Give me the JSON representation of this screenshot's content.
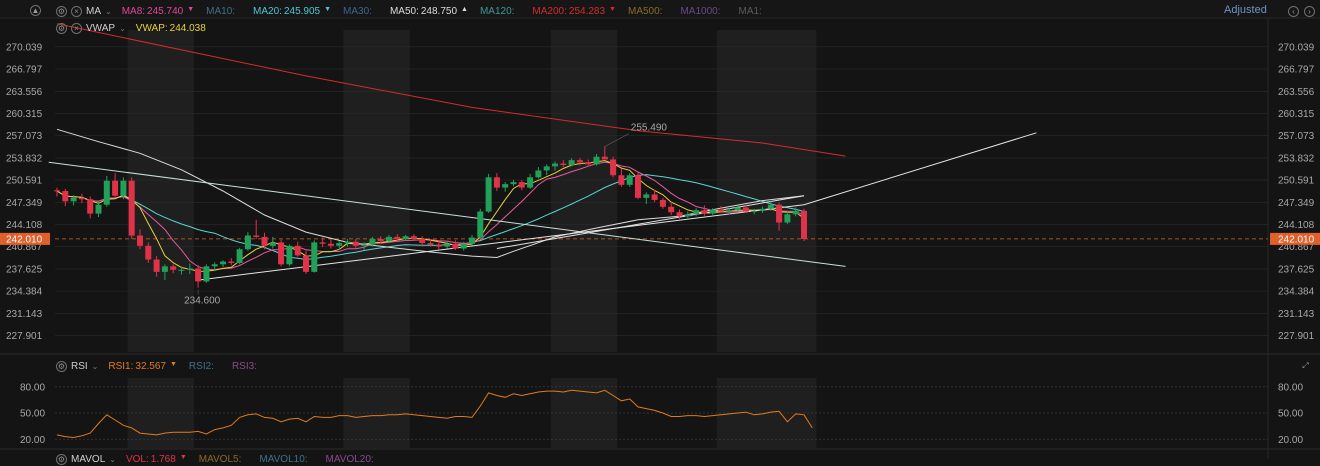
{
  "colors": {
    "bg": "#141414",
    "band": "#1f1f1f",
    "grid": "#2a2a2a",
    "up": "#21a05a",
    "down": "#e0334a",
    "ma8": "#e85aa0",
    "ma20": "#5ad5d5",
    "ma200": "#d62b2b",
    "white": "#e6e6e6",
    "vwap": "#e8d23a",
    "rsi": "#e07b1e",
    "price_line": "#e0602a"
  },
  "top_bar": {
    "collapse_icon": "triangle-up-icon",
    "indicator": "MA",
    "items": [
      {
        "key": "MA8:",
        "value": "245.740",
        "color": "#e0479a",
        "arrow": "▼"
      },
      {
        "key": "MA10:",
        "value": "",
        "color": "#3e7088",
        "arrow": ""
      },
      {
        "key": "MA20:",
        "value": "245.905",
        "color": "#4fc6d6",
        "arrow": "▼"
      },
      {
        "key": "MA30:",
        "value": "",
        "color": "#3e6496",
        "arrow": ""
      },
      {
        "key": "MA50:",
        "value": "248.750",
        "color": "#dcdcdc",
        "arrow": "▲"
      },
      {
        "key": "MA120:",
        "value": "",
        "color": "#3e9a9a",
        "arrow": ""
      },
      {
        "key": "MA200:",
        "value": "254.283",
        "color": "#d62b2b",
        "arrow": "▼"
      },
      {
        "key": "MA500:",
        "value": "",
        "color": "#8a6a2a",
        "arrow": ""
      },
      {
        "key": "MA1000:",
        "value": "",
        "color": "#6a4a8a",
        "arrow": ""
      },
      {
        "key": "MA1:",
        "value": "",
        "color": "#5a5a5a",
        "arrow": ""
      }
    ],
    "adjusted": "Adjusted",
    "nav_left": "‹",
    "nav_right": "›"
  },
  "vwap_bar": {
    "indicator": "VWAP",
    "key": "VWAP:",
    "value": "244.038"
  },
  "rsi_bar": {
    "indicator": "RSI",
    "items": [
      {
        "key": "RSI1:",
        "value": "32.567",
        "color": "#e07b1e",
        "arrow": "▼"
      },
      {
        "key": "RSI2:",
        "value": "",
        "color": "#3e7088",
        "arrow": ""
      },
      {
        "key": "RSI3:",
        "value": "",
        "color": "#8a4a8a",
        "arrow": ""
      }
    ]
  },
  "vol_bar": {
    "indicator": "MAVOL",
    "items": [
      {
        "key": "VOL:",
        "value": "1.768",
        "color": "#e0334a",
        "arrow": "▼"
      },
      {
        "key": "MAVOL5:",
        "value": "",
        "color": "#8a6a2a",
        "arrow": ""
      },
      {
        "key": "MAVOL10:",
        "value": "",
        "color": "#3e7088",
        "arrow": ""
      },
      {
        "key": "MAVOL20:",
        "value": "",
        "color": "#8a4a8a",
        "arrow": ""
      }
    ]
  },
  "chart_data": [
    {
      "type": "candlestick",
      "title": "",
      "y_ticks": [
        "270.039",
        "266.797",
        "263.556",
        "260.315",
        "257.073",
        "253.832",
        "250.591",
        "247.349",
        "244.108",
        "240.867",
        "237.625",
        "234.384",
        "231.143",
        "227.901"
      ],
      "ylim": [
        225.5,
        272.5
      ],
      "current_price": "242.010",
      "annotations": [
        {
          "text": "255.490",
          "value": 255.49
        },
        {
          "text": "234.600",
          "value": 234.6
        }
      ],
      "candles": [
        [
          249.1,
          249.5,
          248.2,
          249.0
        ],
        [
          249.0,
          249.3,
          246.8,
          247.5
        ],
        [
          247.5,
          248.4,
          246.9,
          248.0
        ],
        [
          248.0,
          248.6,
          247.2,
          247.8
        ],
        [
          247.8,
          248.2,
          245.0,
          245.7
        ],
        [
          245.7,
          247.4,
          245.2,
          247.0
        ],
        [
          247.0,
          251.2,
          246.7,
          250.5
        ],
        [
          250.5,
          251.6,
          248.0,
          248.3
        ],
        [
          248.3,
          251.0,
          247.8,
          250.5
        ],
        [
          250.5,
          251.0,
          242.0,
          242.5
        ],
        [
          242.5,
          243.4,
          240.5,
          241.0
        ],
        [
          241.0,
          241.5,
          238.5,
          239.0
        ],
        [
          239.0,
          239.5,
          236.5,
          237.2
        ],
        [
          237.2,
          238.3,
          236.0,
          238.0
        ],
        [
          238.0,
          238.3,
          237.0,
          237.5
        ],
        [
          237.5,
          238.0,
          236.8,
          237.5
        ],
        [
          237.5,
          238.4,
          236.9,
          237.7
        ],
        [
          237.7,
          238.2,
          234.9,
          235.8
        ],
        [
          235.8,
          238.3,
          235.6,
          238.0
        ],
        [
          238.0,
          238.6,
          237.3,
          238.3
        ],
        [
          238.3,
          238.9,
          237.9,
          238.7
        ],
        [
          238.7,
          239.2,
          238.2,
          238.5
        ],
        [
          238.5,
          240.7,
          238.3,
          240.5
        ],
        [
          240.5,
          243.0,
          240.3,
          242.5
        ],
        [
          242.5,
          244.8,
          242.0,
          242.3
        ],
        [
          242.3,
          242.9,
          240.5,
          241.0
        ],
        [
          241.0,
          242.3,
          240.6,
          241.5
        ],
        [
          241.5,
          241.9,
          238.0,
          238.3
        ],
        [
          238.3,
          241.2,
          238.0,
          241.0
        ],
        [
          241.0,
          241.6,
          239.4,
          239.6
        ],
        [
          239.6,
          240.3,
          236.9,
          237.2
        ],
        [
          237.2,
          241.8,
          237.1,
          241.5
        ],
        [
          241.5,
          242.2,
          240.8,
          241.3
        ],
        [
          241.3,
          242.0,
          240.6,
          241.0
        ],
        [
          241.0,
          241.7,
          240.4,
          241.4
        ],
        [
          241.4,
          242.0,
          240.9,
          241.6
        ],
        [
          241.6,
          242.0,
          240.7,
          241.0
        ],
        [
          241.0,
          241.5,
          240.4,
          241.2
        ],
        [
          241.2,
          242.3,
          240.9,
          242.0
        ],
        [
          242.0,
          242.4,
          241.3,
          241.7
        ],
        [
          241.7,
          242.6,
          241.4,
          242.3
        ],
        [
          242.3,
          242.7,
          241.7,
          242.0
        ],
        [
          242.0,
          242.6,
          241.7,
          242.4
        ],
        [
          242.4,
          242.7,
          241.7,
          242.0
        ],
        [
          242.0,
          242.4,
          240.9,
          241.4
        ],
        [
          241.4,
          241.9,
          240.9,
          241.2
        ],
        [
          241.2,
          241.7,
          240.5,
          240.9
        ],
        [
          240.9,
          241.6,
          240.6,
          241.3
        ],
        [
          241.3,
          241.8,
          240.4,
          240.6
        ],
        [
          240.6,
          241.6,
          240.3,
          241.3
        ],
        [
          241.3,
          242.6,
          241.0,
          242.2
        ],
        [
          242.2,
          246.4,
          242.0,
          246.0
        ],
        [
          246.0,
          251.5,
          245.8,
          251.0
        ],
        [
          251.0,
          251.6,
          249.0,
          249.5
        ],
        [
          249.5,
          250.3,
          248.9,
          250.0
        ],
        [
          250.0,
          250.6,
          249.7,
          250.3
        ],
        [
          250.3,
          250.6,
          249.1,
          249.5
        ],
        [
          249.5,
          251.5,
          249.3,
          251.0
        ],
        [
          251.0,
          252.5,
          250.8,
          252.0
        ],
        [
          252.0,
          252.9,
          251.3,
          252.6
        ],
        [
          252.6,
          253.3,
          252.0,
          253.0
        ],
        [
          253.0,
          253.5,
          252.5,
          252.8
        ],
        [
          252.8,
          253.8,
          252.6,
          253.5
        ],
        [
          253.5,
          253.8,
          252.7,
          253.2
        ],
        [
          253.2,
          253.6,
          252.6,
          252.9
        ],
        [
          252.9,
          254.4,
          252.7,
          254.0
        ],
        [
          254.0,
          255.5,
          253.7,
          253.6
        ],
        [
          253.6,
          254.0,
          251.0,
          251.3
        ],
        [
          251.3,
          252.3,
          249.6,
          249.9
        ],
        [
          249.9,
          251.6,
          249.6,
          251.3
        ],
        [
          251.3,
          251.9,
          247.8,
          248.0
        ],
        [
          248.0,
          248.8,
          247.1,
          248.5
        ],
        [
          248.5,
          249.2,
          247.4,
          247.7
        ],
        [
          247.7,
          248.0,
          246.4,
          246.7
        ],
        [
          246.7,
          247.4,
          245.5,
          245.9
        ],
        [
          245.9,
          246.3,
          244.9,
          245.3
        ],
        [
          245.3,
          246.0,
          244.9,
          245.6
        ],
        [
          245.6,
          246.5,
          245.3,
          246.2
        ],
        [
          246.2,
          246.9,
          245.4,
          245.7
        ],
        [
          245.7,
          246.5,
          245.5,
          246.3
        ],
        [
          246.3,
          246.8,
          245.8,
          246.0
        ],
        [
          246.0,
          246.5,
          245.6,
          246.2
        ],
        [
          246.2,
          246.9,
          245.9,
          246.6
        ],
        [
          246.6,
          247.0,
          245.8,
          246.0
        ],
        [
          246.0,
          246.4,
          245.6,
          246.1
        ],
        [
          246.1,
          246.7,
          245.8,
          246.4
        ],
        [
          246.4,
          247.5,
          246.1,
          247.0
        ],
        [
          247.0,
          247.3,
          243.2,
          244.4
        ],
        [
          244.4,
          246.0,
          244.2,
          245.6
        ],
        [
          245.6,
          246.6,
          245.3,
          246.1
        ],
        [
          246.1,
          246.4,
          241.7,
          242.0
        ]
      ],
      "indicators": [
        {
          "name": "MA200",
          "color": "#d62b2b",
          "points": [
            [
              0,
              273.4
            ],
            [
              30,
              265.8
            ],
            [
              50,
              261.2
            ],
            [
              70,
              257.8
            ],
            [
              85,
              256.0
            ],
            [
              95,
              254.1
            ]
          ]
        },
        {
          "name": "MA50",
          "color": "#dcdcdc",
          "points": [
            [
              0,
              258.0
            ],
            [
              5,
              256.2
            ],
            [
              10,
              254.5
            ],
            [
              15,
              252.1
            ],
            [
              20,
              249.0
            ],
            [
              25,
              245.5
            ],
            [
              30,
              243.0
            ],
            [
              35,
              241.5
            ],
            [
              40,
              240.8
            ],
            [
              45,
              240.1
            ],
            [
              50,
              239.5
            ],
            [
              53,
              239.3
            ],
            [
              55,
              240.2
            ],
            [
              60,
              242.3
            ],
            [
              65,
              243.6
            ],
            [
              70,
              244.8
            ],
            [
              75,
              245.3
            ],
            [
              80,
              246.5
            ],
            [
              85,
              247.6
            ],
            [
              90,
              248.3
            ]
          ]
        }
      ],
      "trendlines": [
        {
          "name": "upper-descending",
          "color": "#c8e0e0",
          "points": [
            [
              -1,
              253.2
            ],
            [
              95,
              238.0
            ]
          ]
        },
        {
          "name": "lower-ascending",
          "color": "#e6e6e6",
          "points": [
            [
              17,
              236.0
            ],
            [
              90,
              247.0
            ],
            [
              118,
              257.5
            ]
          ]
        },
        {
          "name": "lower-channel",
          "color": "#e6e6e6",
          "points": [
            [
              53,
              240.6
            ],
            [
              90,
              248.3
            ]
          ]
        }
      ]
    },
    {
      "type": "line",
      "name": "RSI",
      "y_ticks": [
        "80.00",
        "50.00",
        "20.00"
      ],
      "ylim": [
        10,
        90
      ],
      "values": [
        25,
        23,
        22,
        24,
        27,
        38,
        48,
        42,
        36,
        33,
        27,
        26,
        25,
        27,
        28,
        28,
        28,
        29,
        26,
        31,
        33,
        36,
        45,
        48,
        49,
        45,
        44,
        40,
        43,
        44,
        40,
        46,
        45,
        45,
        47,
        47,
        45,
        46,
        47,
        47,
        48,
        48,
        49,
        48,
        47,
        46,
        45,
        44,
        46,
        46,
        45,
        58,
        73,
        70,
        68,
        72,
        70,
        72,
        74,
        75,
        75,
        74,
        76,
        75,
        74,
        73,
        76,
        70,
        64,
        66,
        57,
        55,
        53,
        50,
        46,
        46,
        47,
        47,
        46,
        47,
        48,
        49,
        50,
        51,
        48,
        49,
        51,
        52,
        40,
        49,
        48,
        33
      ]
    }
  ]
}
